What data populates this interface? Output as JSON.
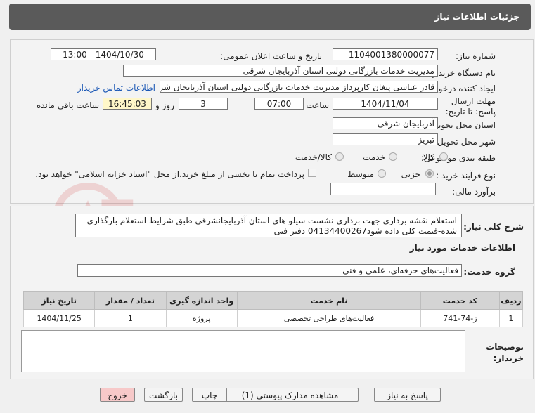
{
  "header": {
    "title": "جزئیات اطلاعات نیاز"
  },
  "form": {
    "need_number_label": "شماره نیاز:",
    "need_number": "1104001380000077",
    "announce_label": "تاریخ و ساعت اعلان عمومی:",
    "announce_value": "1404/10/30 - 13:00",
    "buyer_org_label": "نام دستگاه خریدار:",
    "buyer_org": "مدیریت خدمات بازرگانی دولتی استان آذربایجان شرقی",
    "requester_label": "ایجاد کننده درخواست:",
    "requester": "قادر عباسی پیغان کارپرداز مدیریت خدمات بازرگانی دولتی استان آذربایجان شرقی",
    "contact_link": "اطلاعات تماس خریدار",
    "deadline_label": "مهلت ارسال پاسخ: تا تاریخ:",
    "deadline_date": "1404/11/04",
    "time_label": "ساعت",
    "deadline_time": "07:00",
    "days_value": "3",
    "days_label": "روز و",
    "remaining_time": "16:45:03",
    "remaining_label": "ساعت باقی مانده",
    "province_label": "استان محل تحویل:",
    "province": "آذربایجان شرقی",
    "city_label": "شهر محل تحویل:",
    "city": "تبریز",
    "category_label": "طبقه بندی موضوعی:",
    "category_options": [
      "کالا",
      "خدمت",
      "کالا/خدمت"
    ],
    "process_label": "نوع فرآیند خرید :",
    "process_options": [
      "جزیی",
      "متوسط"
    ],
    "payment_note": "پرداخت تمام یا بخشی از مبلغ خرید،از محل \"اسناد خزانه اسلامی\" خواهد بود.",
    "estimate_label": "برآورد مالی:",
    "estimate_value": ""
  },
  "description": {
    "label": "شرح کلی نیاز:",
    "text": "استعلام نقشه برداری جهت برداری نشست سیلو های استان آذربایجانشرقی طبق شرایط استعلام بارگذاری شده-قیمت کلی داده شود04134400267 دفتر فنی"
  },
  "services": {
    "section_title": "اطلاعات خدمات مورد نیاز",
    "group_label": "گروه خدمت:",
    "group_value": "فعالیت‌های حرفه‌ای، علمی و فنی",
    "columns": [
      "ردیف",
      "کد خدمت",
      "نام خدمت",
      "واحد اندازه گیری",
      "تعداد / مقدار",
      "تاریخ نیاز"
    ],
    "rows": [
      [
        "1",
        "ز-74-741",
        "فعالیت‌های طراحی تخصصی",
        "پروژه",
        "1",
        "1404/11/25"
      ]
    ]
  },
  "notes": {
    "label": "توضیحات خریدار:",
    "value": ""
  },
  "buttons": {
    "reply": "پاسخ به نیاز",
    "attachments": "مشاهده مدارک پیوستی (1)",
    "print": "چاپ",
    "back": "بازگشت",
    "exit": "خروج"
  },
  "watermark": "AriaTender.neT",
  "colors": {
    "header_bg": "#5a5a5a",
    "remaining_bg": "#fff7c9",
    "exit_bg": "#f7c9c9",
    "link": "#1a57b5"
  }
}
